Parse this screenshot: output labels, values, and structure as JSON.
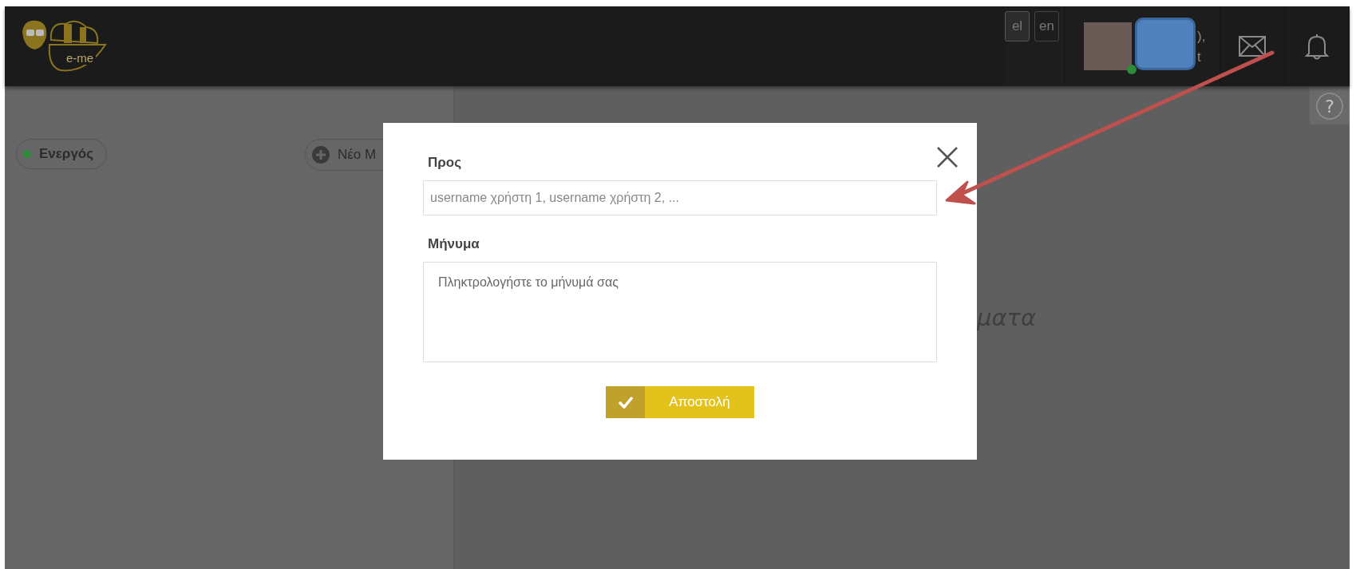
{
  "header": {
    "logo_text": "e-me",
    "languages": [
      {
        "label": "el",
        "selected": true
      },
      {
        "label": "en",
        "selected": false
      }
    ],
    "user": {
      "name_fragments": [
        "),",
        "t"
      ],
      "online": true
    }
  },
  "help": {
    "label": "?"
  },
  "left_panel": {
    "status": {
      "label": "Ενεργός",
      "color": "#2e8b3a"
    },
    "new_button": "Νέο Μ"
  },
  "right_panel": {
    "empty_text": "ματα"
  },
  "dialog": {
    "to_label": "Προς",
    "to_placeholder": "username χρήστη 1, username χρήστη 2, ...",
    "message_label": "Μήνυμα",
    "message_placeholder": "Πληκτρολογήστε το μήνυμά σας",
    "send_button": "Αποστολή"
  }
}
